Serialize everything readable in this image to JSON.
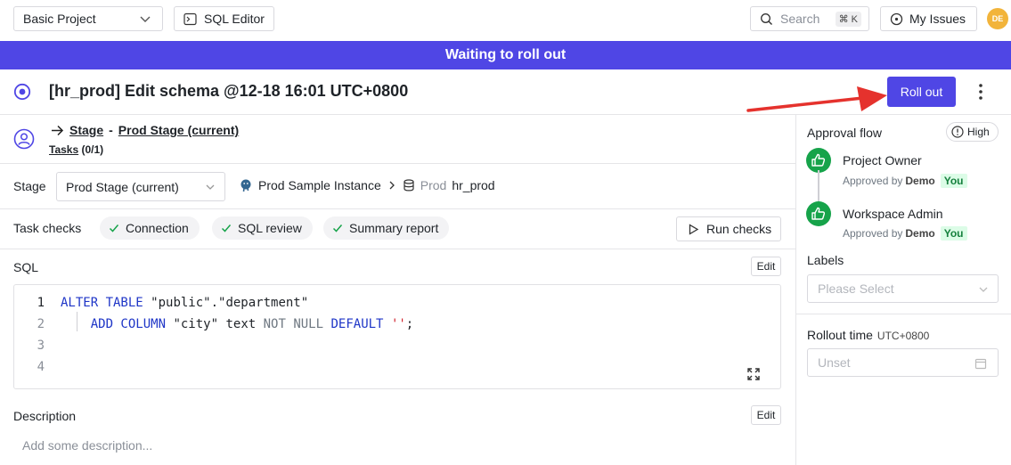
{
  "topbar": {
    "project_select": "Basic Project",
    "sql_editor_label": "SQL Editor",
    "search_placeholder": "Search",
    "search_shortcut": "⌘ K",
    "my_issues_label": "My Issues",
    "avatar_initials": "DE"
  },
  "banner": {
    "text": "Waiting to roll out"
  },
  "issue": {
    "title": "[hr_prod] Edit schema @12-18 16:01 UTC+0800",
    "rollout_label": "Roll out"
  },
  "stage_header": {
    "stage_word": "Stage",
    "separator": "-",
    "stage_name": "Prod Stage (current)",
    "tasks_word": "Tasks",
    "tasks_count": "(0/1)"
  },
  "stage_row": {
    "label": "Stage",
    "selected": "Prod Stage (current)",
    "instance": "Prod Sample Instance",
    "env": "Prod",
    "database": "hr_prod"
  },
  "checks": {
    "label": "Task checks",
    "items": [
      "Connection",
      "SQL review",
      "Summary report"
    ],
    "run_label": "Run checks"
  },
  "sql": {
    "label": "SQL",
    "edit_label": "Edit",
    "line_numbers": [
      "1",
      "2",
      "3",
      "4"
    ]
  },
  "description": {
    "label": "Description",
    "edit_label": "Edit",
    "placeholder": "Add some description..."
  },
  "approval": {
    "title": "Approval flow",
    "risk": "High",
    "steps": [
      {
        "role": "Project Owner",
        "approved_prefix": "Approved by",
        "approver": "Demo",
        "you": "You"
      },
      {
        "role": "Workspace Admin",
        "approved_prefix": "Approved by",
        "approver": "Demo",
        "you": "You"
      }
    ]
  },
  "labels": {
    "title": "Labels",
    "placeholder": "Please Select"
  },
  "rollout_time": {
    "title": "Rollout time",
    "timezone": "UTC+0800",
    "placeholder": "Unset"
  },
  "colors": {
    "primary": "#4f46e5",
    "approved_green": "#16a34a",
    "annotation_arrow": "#e5322d"
  }
}
